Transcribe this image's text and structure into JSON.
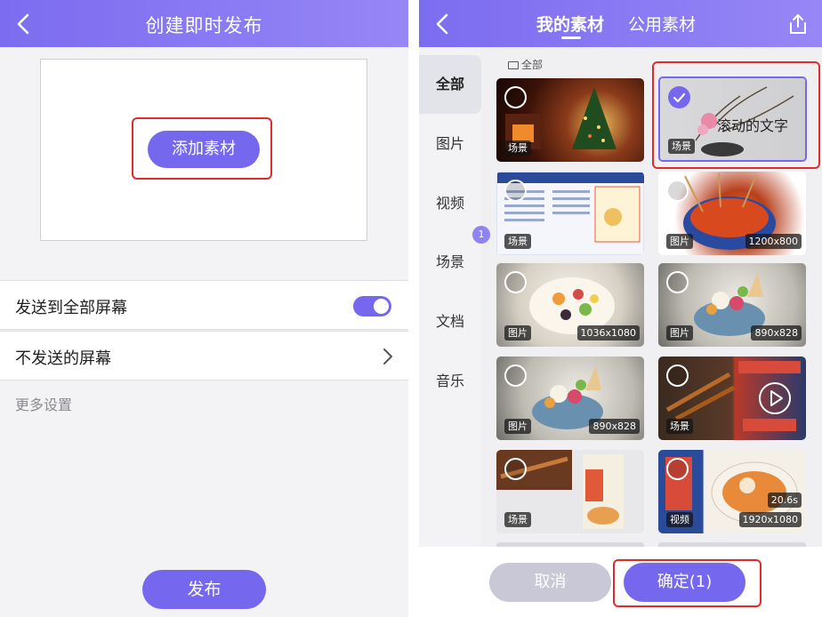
{
  "left_screen": {
    "header": {
      "title": "创建即时发布"
    },
    "upload": {
      "add_label": "添加素材"
    },
    "settings": {
      "send_all_label": "发送到全部屏幕",
      "send_all_enabled": true,
      "exclude_label": "不发送的屏幕",
      "more_label": "更多设置"
    },
    "publish_label": "发布"
  },
  "right_screen": {
    "header": {
      "tab_mine": "我的素材",
      "tab_public": "公用素材"
    },
    "breadcrumb": "全部",
    "categories": [
      "全部",
      "图片",
      "视频",
      "场景",
      "文档",
      "音乐"
    ],
    "active_category": "全部",
    "selected_count_badge": "1",
    "items": [
      {
        "type": "场景",
        "resolution": "",
        "duration": "",
        "selected": false,
        "theme": "christmas"
      },
      {
        "type": "场景",
        "resolution": "",
        "duration": "",
        "selected": true,
        "overlay": "滚动的文字",
        "theme": "flower"
      },
      {
        "type": "场景",
        "resolution": "",
        "duration": "",
        "selected": false,
        "theme": "menu"
      },
      {
        "type": "图片",
        "resolution": "1200x800",
        "duration": "",
        "selected": false,
        "theme": "skewers"
      },
      {
        "type": "图片",
        "resolution": "1036x1080",
        "duration": "",
        "selected": false,
        "theme": "fruit"
      },
      {
        "type": "图片",
        "resolution": "890x828",
        "duration": "",
        "selected": false,
        "theme": "fruit2"
      },
      {
        "type": "图片",
        "resolution": "890x828",
        "duration": "",
        "selected": false,
        "theme": "fruit3"
      },
      {
        "type": "场景",
        "resolution": "",
        "duration": "",
        "selected": false,
        "theme": "bbq-play"
      },
      {
        "type": "场景",
        "resolution": "",
        "duration": "",
        "selected": false,
        "theme": "bbq-noodle"
      },
      {
        "type": "视频",
        "resolution": "1920x1080",
        "duration": "20.6s",
        "selected": false,
        "theme": "noodle"
      }
    ],
    "cancel_label": "取消",
    "confirm_label": "确定(1)"
  },
  "colors": {
    "accent": "#7667ef",
    "highlight": "#e32a2a",
    "cancel": "#c8c8d6"
  }
}
